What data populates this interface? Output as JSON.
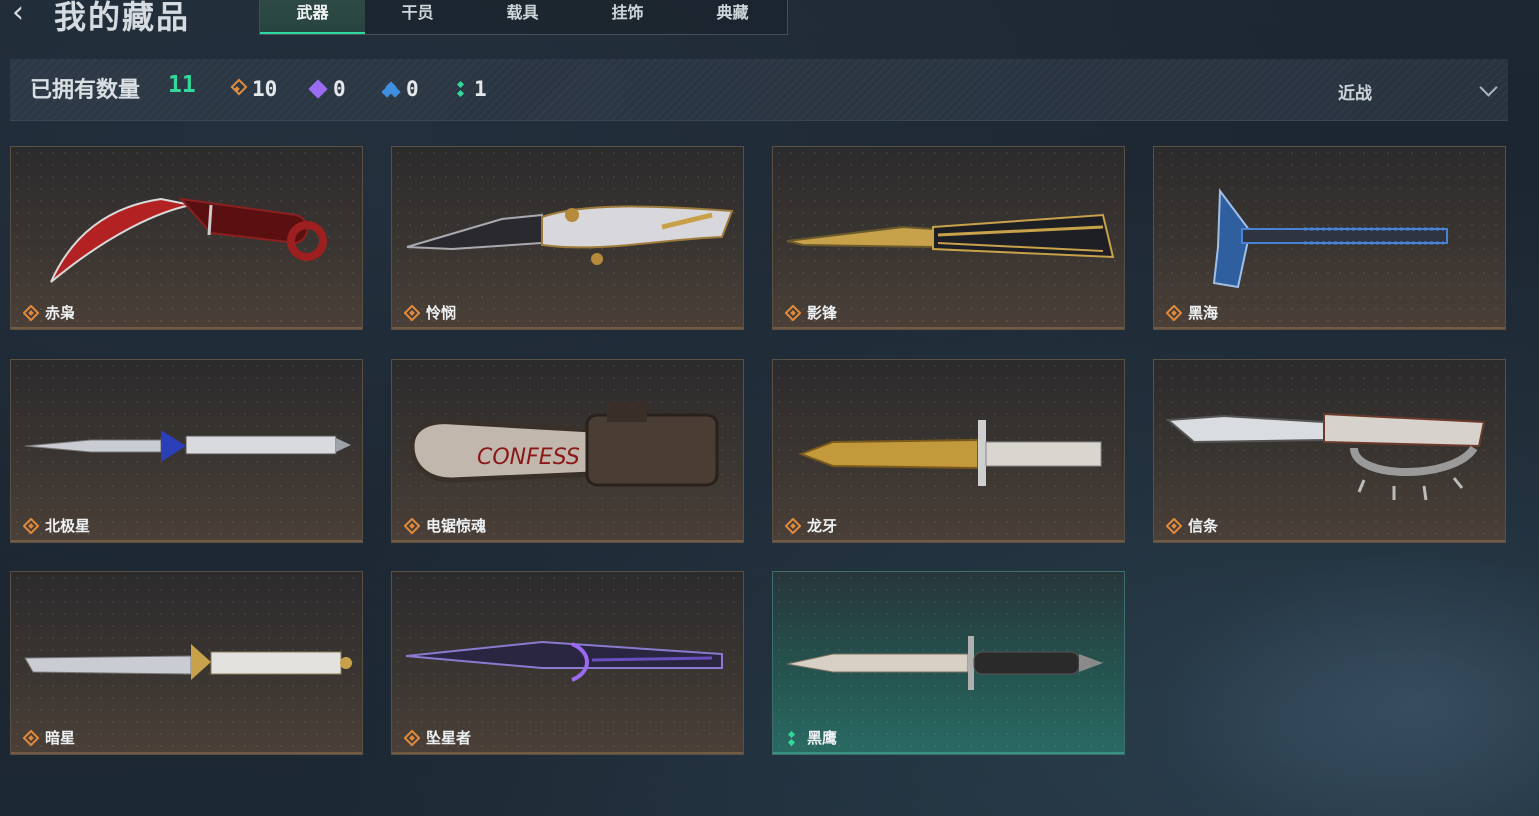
{
  "header": {
    "title": "我的藏品",
    "tabs": [
      {
        "label": "武器",
        "active": true
      },
      {
        "label": "干员",
        "active": false
      },
      {
        "label": "载具",
        "active": false
      },
      {
        "label": "挂饰",
        "active": false
      },
      {
        "label": "典藏",
        "active": false
      }
    ]
  },
  "ownership": {
    "label": "已拥有数量",
    "total": "11",
    "counts": [
      {
        "icon": "orange-diamond-icon",
        "color": "#e08a3c",
        "value": "10"
      },
      {
        "icon": "purple-diamond-icon",
        "color": "#9b6cf0",
        "value": "0"
      },
      {
        "icon": "blue-diamond-icon",
        "color": "#3f8fe0",
        "value": "0"
      },
      {
        "icon": "green-diamond-icon",
        "color": "#34d89a",
        "value": "1"
      }
    ],
    "filter_selected": "近战"
  },
  "colors": {
    "accent_green": "#34d89a",
    "rarity_orange": "#e08a3c"
  },
  "weapons": [
    {
      "name": "赤枭",
      "rarity": "orange"
    },
    {
      "name": "怜悯",
      "rarity": "orange"
    },
    {
      "name": "影锋",
      "rarity": "orange"
    },
    {
      "name": "黑海",
      "rarity": "orange"
    },
    {
      "name": "北极星",
      "rarity": "orange"
    },
    {
      "name": "电锯惊魂",
      "rarity": "orange"
    },
    {
      "name": "龙牙",
      "rarity": "orange"
    },
    {
      "name": "信条",
      "rarity": "orange"
    },
    {
      "name": "暗星",
      "rarity": "orange"
    },
    {
      "name": "坠星者",
      "rarity": "orange"
    },
    {
      "name": "黑鹰",
      "rarity": "green"
    }
  ]
}
